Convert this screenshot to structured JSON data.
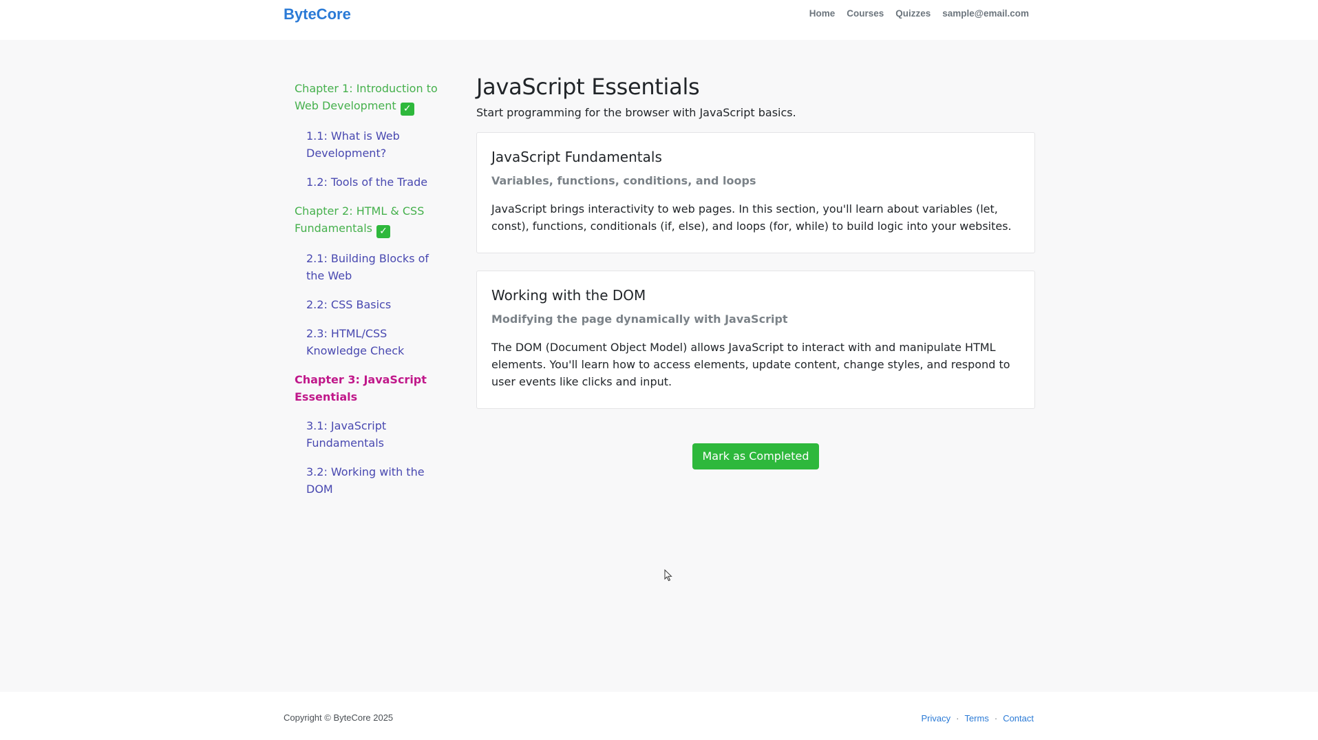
{
  "header": {
    "brand": "ByteCore",
    "nav": [
      "Home",
      "Courses",
      "Quizzes",
      "sample@email.com"
    ]
  },
  "sidebar": {
    "items": [
      {
        "type": "chapter",
        "label": "Chapter 1: Introduction to Web Development",
        "completed": true,
        "active": false
      },
      {
        "type": "section",
        "label": "1.1: What is Web Development?"
      },
      {
        "type": "section",
        "label": "1.2: Tools of the Trade"
      },
      {
        "type": "chapter",
        "label": "Chapter 2: HTML & CSS Fundamentals",
        "completed": true,
        "active": false
      },
      {
        "type": "section",
        "label": "2.1: Building Blocks of the Web"
      },
      {
        "type": "section",
        "label": "2.2: CSS Basics"
      },
      {
        "type": "section",
        "label": "2.3: HTML/CSS Knowledge Check"
      },
      {
        "type": "chapter",
        "label": "Chapter 3: JavaScript Essentials",
        "completed": false,
        "active": true
      },
      {
        "type": "section",
        "label": "3.1: JavaScript Fundamentals"
      },
      {
        "type": "section",
        "label": "3.2: Working with the DOM"
      }
    ],
    "check_glyph": "✓"
  },
  "main": {
    "title": "JavaScript Essentials",
    "subtitle": "Start programming for the browser with JavaScript basics.",
    "cards": [
      {
        "title": "JavaScript Fundamentals",
        "subtitle": "Variables, functions, conditions, and loops",
        "text": "JavaScript brings interactivity to web pages. In this section, you'll learn about variables (let, const), functions, conditionals (if, else), and loops (for, while) to build logic into your websites."
      },
      {
        "title": "Working with the DOM",
        "subtitle": "Modifying the page dynamically with JavaScript",
        "text": "The DOM (Document Object Model) allows JavaScript to interact with and manipulate HTML elements. You'll learn how to access elements, update content, change styles, and respond to user events like clicks and input."
      }
    ],
    "complete_button": "Mark as Completed"
  },
  "footer": {
    "copyright": "Copyright © ByteCore 2025",
    "links": [
      "Privacy",
      "Terms",
      "Contact"
    ],
    "separator": "·"
  },
  "colors": {
    "brand": "#2a7ad6",
    "chapter_done": "#45b04c",
    "chapter_active": "#c0188a",
    "section_link": "#4848b0",
    "success": "#2eb83c"
  }
}
